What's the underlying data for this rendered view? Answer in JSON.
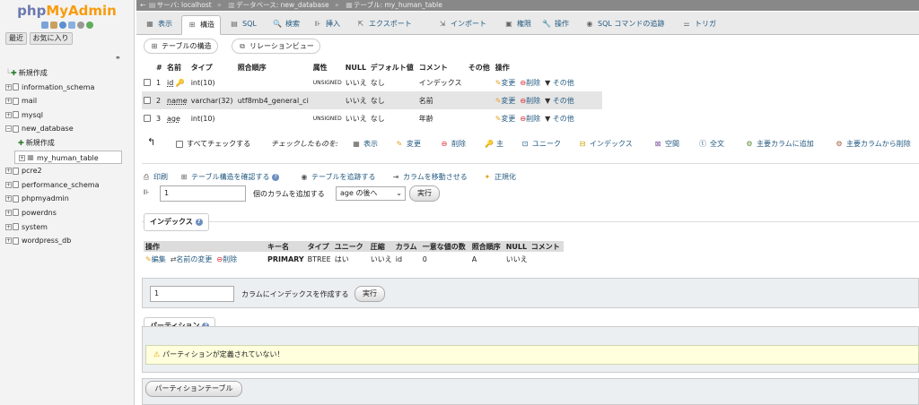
{
  "left": {
    "logo_php": "php",
    "logo_myadmin": "MyAdmin",
    "tabs": [
      "最近",
      "お気に入り"
    ],
    "tree": [
      {
        "label": "新規作成",
        "kind": "new"
      },
      {
        "label": "information_schema",
        "kind": "db"
      },
      {
        "label": "mail",
        "kind": "db"
      },
      {
        "label": "mysql",
        "kind": "db"
      },
      {
        "label": "new_database",
        "kind": "db-open"
      },
      {
        "label": "新規作成",
        "kind": "sub-new"
      },
      {
        "label": "my_human_table",
        "kind": "table-active"
      },
      {
        "label": "pcre2",
        "kind": "db"
      },
      {
        "label": "performance_schema",
        "kind": "db"
      },
      {
        "label": "phpmyadmin",
        "kind": "db"
      },
      {
        "label": "powerdns",
        "kind": "db"
      },
      {
        "label": "system",
        "kind": "db"
      },
      {
        "label": "wordpress_db",
        "kind": "db"
      }
    ]
  },
  "breadcrumb": {
    "server": "サーバ: localhost",
    "database": "データベース: new_database",
    "table": "テーブル: my_human_table"
  },
  "tabs": [
    {
      "label": "表示",
      "icon": "browse-icon"
    },
    {
      "label": "構造",
      "icon": "structure-icon",
      "active": true
    },
    {
      "label": "SQL",
      "icon": "sql-icon"
    },
    {
      "label": "検索",
      "icon": "search-icon"
    },
    {
      "label": "挿入",
      "icon": "insert-icon"
    },
    {
      "label": "エクスポート",
      "icon": "export-icon"
    },
    {
      "label": "インポート",
      "icon": "import-icon"
    },
    {
      "label": "権限",
      "icon": "privileges-icon"
    },
    {
      "label": "操作",
      "icon": "operations-icon"
    },
    {
      "label": "SQL コマンドの追跡",
      "icon": "tracking-icon"
    },
    {
      "label": "トリガ",
      "icon": "triggers-icon"
    }
  ],
  "subtabs": {
    "structure": "テーブルの構造",
    "relation": "リレーションビュー"
  },
  "columns_table": {
    "headers": [
      "#",
      "名前",
      "タイプ",
      "照合順序",
      "属性",
      "NULL",
      "デフォルト値",
      "コメント",
      "その他",
      "操作"
    ],
    "rows": [
      {
        "num": "1",
        "name": "id",
        "type": "int(10)",
        "collation": "",
        "attr": "UNSIGNED",
        "null": "いいえ",
        "default": "なし",
        "comment": "インデックス",
        "extra": "",
        "primary": true
      },
      {
        "num": "2",
        "name": "name",
        "type": "varchar(32)",
        "collation": "utf8mb4_general_ci",
        "attr": "",
        "null": "いいえ",
        "default": "なし",
        "comment": "名前",
        "extra": "",
        "primary": false
      },
      {
        "num": "3",
        "name": "age",
        "type": "int(10)",
        "collation": "",
        "attr": "UNSIGNED",
        "null": "いいえ",
        "default": "なし",
        "comment": "年齢",
        "extra": "",
        "primary": false
      }
    ],
    "row_actions": {
      "change": "変更",
      "drop": "削除",
      "more": "その他"
    }
  },
  "check_all": {
    "label": "すべてチェックする",
    "with_selected": "チェックしたものを:",
    "actions": [
      "表示",
      "変更",
      "削除",
      "主",
      "ユニーク",
      "インデックス",
      "空間",
      "全文",
      "主要カラムに追加",
      "主要カラムから削除"
    ]
  },
  "table_actions": {
    "print": "印刷",
    "propose": "テーブル構造を確認する",
    "track": "テーブルを追跡する",
    "move": "カラムを移動させる",
    "normalize": "正規化"
  },
  "add_columns": {
    "count": "1",
    "label": "個のカラムを追加する",
    "position": "age の後へ",
    "go": "実行"
  },
  "indexes": {
    "legend": "インデックス",
    "headers": [
      "操作",
      "キー名",
      "タイプ",
      "ユニーク",
      "圧縮",
      "カラム",
      "一意な値の数",
      "照合順序",
      "NULL",
      "コメント"
    ],
    "row": {
      "edit": "編集",
      "rename": "名前の変更",
      "drop": "削除",
      "keyname": "PRIMARY",
      "type": "BTREE",
      "unique": "はい",
      "packed": "いいえ",
      "column": "id",
      "cardinality": "0",
      "collation": "A",
      "null": "いいえ",
      "comment": ""
    },
    "create_count": "1",
    "create_label": "カラムにインデックスを作成する",
    "go": "実行"
  },
  "partitions": {
    "legend": "パーティション",
    "notice": "パーティションが定義されていない！",
    "button": "パーティションテーブル"
  },
  "colors": {
    "link": "#235a81",
    "accent_orange": "#f89c0e",
    "logo_blue": "#6c78af"
  }
}
